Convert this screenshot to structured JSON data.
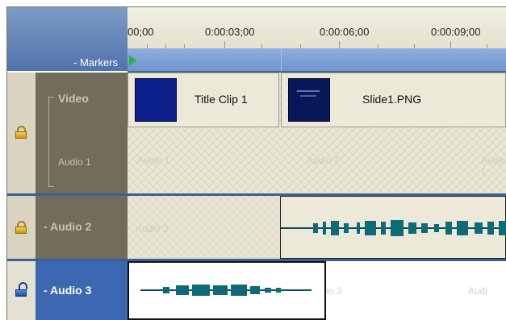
{
  "ruler": {
    "ticks": [
      "00;00",
      "0:00:03;00",
      "0:00:06;00",
      "0:00:09;00"
    ]
  },
  "markers": {
    "label": "- Markers"
  },
  "tracks": {
    "video": {
      "name": "Video"
    },
    "audio1": {
      "name": "Audio 1",
      "ghost": "Audio 1"
    },
    "audio2": {
      "name": "- Audio 2",
      "ghost": "Audio 2"
    },
    "audio3": {
      "name": "- Audio 3",
      "ghost_a": "io 3",
      "ghost_b": "Audi"
    }
  },
  "clips": {
    "title_clip": {
      "label": "Title Clip 1"
    },
    "slide_clip": {
      "label": "Slide1.PNG"
    }
  },
  "colors": {
    "accent": "#3b68b0",
    "lock_closed": "#e8be2b",
    "lock_open": "#2f5fc4",
    "waveform": "#0e6a78"
  }
}
